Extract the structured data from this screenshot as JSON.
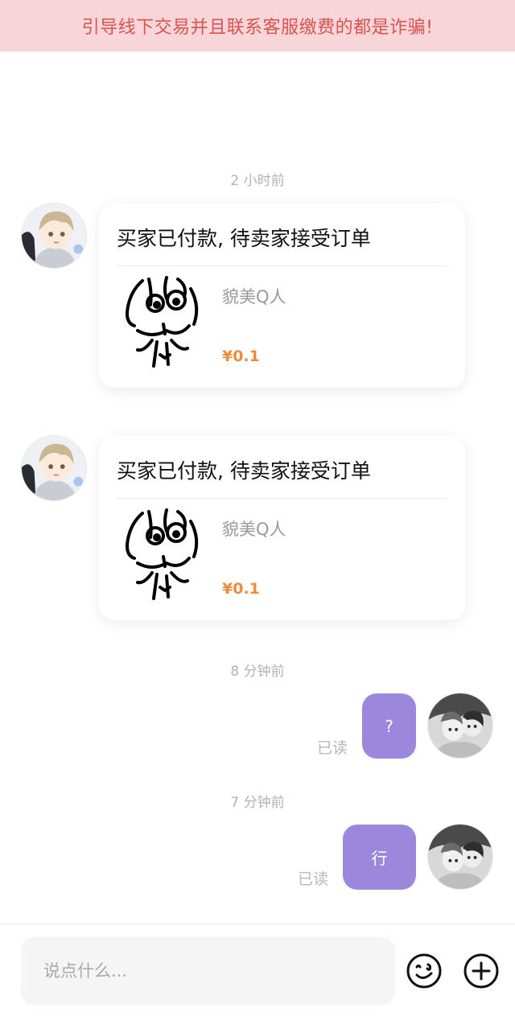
{
  "warning": {
    "text": "引导线下交易并且联系客服缴费的都是诈骗!"
  },
  "messages": {
    "timestamps": [
      "2 小时前",
      "8 分钟前",
      "7 分钟前"
    ],
    "order_cards": [
      {
        "title": "买家已付款, 待卖家接受订单",
        "product_name": "貌美Q人",
        "price": "¥0.1"
      },
      {
        "title": "买家已付款, 待卖家接受订单",
        "product_name": "貌美Q人",
        "price": "¥0.1"
      }
    ],
    "outgoing": [
      {
        "text": "?",
        "status": "已读"
      },
      {
        "text": "行",
        "status": "已读"
      }
    ]
  },
  "input": {
    "placeholder": "说点什么..."
  },
  "icons": {
    "emoji": "emoji-icon",
    "add": "plus-circle-icon"
  },
  "colors": {
    "warning_bg": "#f7d5d8",
    "warning_text": "#d9534f",
    "bubble": "#9b88dd",
    "price": "#f08a3c"
  }
}
